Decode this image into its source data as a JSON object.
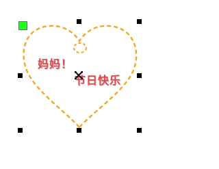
{
  "heart_text": {
    "line1": "妈妈！",
    "line2": "节日快乐"
  },
  "colors": {
    "heart_outline": "#f5a623",
    "text": "#e0474d",
    "rotate_handle": "#18ff18",
    "selection_handle": "#000000"
  },
  "icons": {
    "rotate_handle": "rotate-handle-icon",
    "cursor": "move-cursor-icon"
  }
}
